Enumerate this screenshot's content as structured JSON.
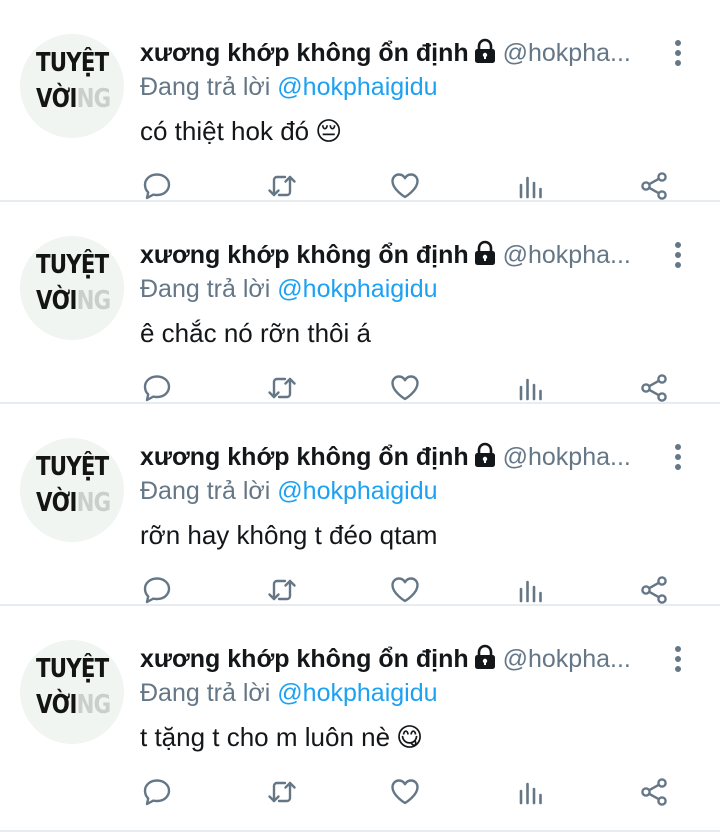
{
  "tweets": [
    {
      "avatar": {
        "line1": "TUYỆT",
        "line2_strong": "VỜI",
        "line2_faded": "NG"
      },
      "name": "xương khớp không ổn định",
      "handle": "@hokpha...",
      "reply_prefix": "Đang trả lời",
      "reply_to": "@hokphaigidu",
      "text": "có thiệt hok đó",
      "emoji": "😔"
    },
    {
      "avatar": {
        "line1": "TUYỆT",
        "line2_strong": "VỜI",
        "line2_faded": "NG"
      },
      "name": "xương khớp không ổn định",
      "handle": "@hokpha...",
      "reply_prefix": "Đang trả lời",
      "reply_to": "@hokphaigidu",
      "text": "ê chắc nó rỡn thôi á",
      "emoji": ""
    },
    {
      "avatar": {
        "line1": "TUYỆT",
        "line2_strong": "VỜI",
        "line2_faded": "NG"
      },
      "name": "xương khớp không ổn định",
      "handle": "@hokpha...",
      "reply_prefix": "Đang trả lời",
      "reply_to": "@hokphaigidu",
      "text": "rỡn hay không t đéo qtam",
      "emoji": ""
    },
    {
      "avatar": {
        "line1": "TUYỆT",
        "line2_strong": "VỜI",
        "line2_faded": "NG"
      },
      "name": "xương khớp không ổn định",
      "handle": "@hokpha...",
      "reply_prefix": "Đang trả lời",
      "reply_to": "@hokphaigidu",
      "text": "t tặng t cho m luôn nè",
      "emoji": "😋"
    }
  ],
  "icons": {
    "lock": "lock-icon",
    "more": "more-vertical-icon",
    "reply": "reply-icon",
    "retweet": "retweet-icon",
    "like": "heart-icon",
    "stats": "analytics-icon",
    "share": "share-icon"
  },
  "colors": {
    "name": "#14171a",
    "secondary": "#657786",
    "mention": "#1da1f2",
    "divider": "#e6ecf0"
  }
}
